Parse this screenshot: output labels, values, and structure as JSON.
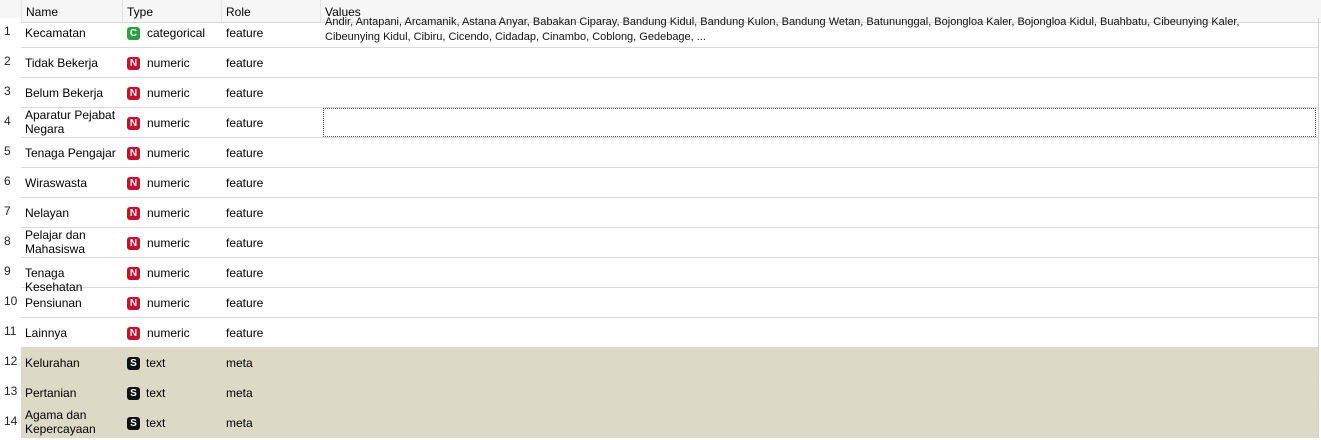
{
  "header": {
    "name": "Name",
    "type": "Type",
    "role": "Role",
    "values": "Values"
  },
  "rows": [
    {
      "num": "1",
      "name": "Kecamatan",
      "type_badge": "C",
      "type": "categorical",
      "role": "feature",
      "values_line1": "Andir, Antapani, Arcamanik, Astana Anyar, Babakan Ciparay, Bandung Kidul, Bandung Kulon, Bandung Wetan, Batununggal, Bojongloa Kaler, Bojongloa Kidul, Buahbatu, Cibeunying Kaler,",
      "values_line2": "Cibeunying Kidul, Cibiru, Cicendo, Cidadap, Cinambo, Coblong, Gedebage, ..."
    },
    {
      "num": "2",
      "name": "Tidak Bekerja",
      "type_badge": "N",
      "type": "numeric",
      "role": "feature"
    },
    {
      "num": "3",
      "name": "Belum Bekerja",
      "type_badge": "N",
      "type": "numeric",
      "role": "feature"
    },
    {
      "num": "4",
      "name": "Aparatur Pejabat Negara",
      "type_badge": "N",
      "type": "numeric",
      "role": "feature"
    },
    {
      "num": "5",
      "name": "Tenaga Pengajar",
      "type_badge": "N",
      "type": "numeric",
      "role": "feature"
    },
    {
      "num": "6",
      "name": "Wiraswasta",
      "type_badge": "N",
      "type": "numeric",
      "role": "feature"
    },
    {
      "num": "7",
      "name": "Nelayan",
      "type_badge": "N",
      "type": "numeric",
      "role": "feature"
    },
    {
      "num": "8",
      "name": "Pelajar dan Mahasiswa",
      "type_badge": "N",
      "type": "numeric",
      "role": "feature"
    },
    {
      "num": "9",
      "name": "Tenaga Kesehatan",
      "type_badge": "N",
      "type": "numeric",
      "role": "feature"
    },
    {
      "num": "10",
      "name": "Pensiunan",
      "type_badge": "N",
      "type": "numeric",
      "role": "feature"
    },
    {
      "num": "11",
      "name": "Lainnya",
      "type_badge": "N",
      "type": "numeric",
      "role": "feature"
    },
    {
      "num": "12",
      "name": "Kelurahan",
      "type_badge": "S",
      "type": "text",
      "role": "meta"
    },
    {
      "num": "13",
      "name": "Pertanian",
      "type_badge": "S",
      "type": "text",
      "role": "meta"
    },
    {
      "num": "14",
      "name": "Agama dan Kepercayaan",
      "type_badge": "S",
      "type": "text",
      "role": "meta"
    }
  ],
  "colors": {
    "meta_row": "#dcdac6",
    "categorical": "#28a046",
    "numeric": "#c8102e",
    "text": "#111111"
  }
}
